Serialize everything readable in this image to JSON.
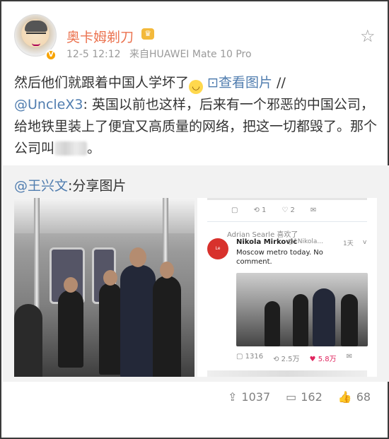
{
  "header": {
    "username": "奥卡姆剃刀",
    "timestamp": "12-5 12:12",
    "source": "来自HUAWEI Mate 10 Pro",
    "verified_badge": "V",
    "crown_badge": "♛",
    "favorite_icon": "star-icon"
  },
  "post": {
    "line1_text": "然后他们就跟着中国人学坏了",
    "emoji_glyph": "😂",
    "view_image_link": "查看图片",
    "view_image_prefix": "⊡",
    "separator": "//",
    "mention": "@UncleX3",
    "quote_text": ": 英国以前也这样，后来有一个邪恶的中国公司，给地铁里装上了便宜又高质量的网络，把这一切都毁了。那个公司叫",
    "quote_end": "。"
  },
  "retweet": {
    "mention": "@王兴文",
    "text": ":分享图片"
  },
  "twitter_screenshot": {
    "top_actions": [
      "▢",
      "⟲ 1",
      "♡ 2",
      "✉"
    ],
    "liked_by": "Adrian Searle 喜欢了",
    "author_name": "Nikola Mirkovic",
    "author_handle": "@1Nikola...",
    "time": "1天",
    "chevron": "v",
    "avatar_text": "Le marteau",
    "tweet_text": "Moscow metro today. No comment.",
    "stats": [
      "▢ 1316",
      "⟲ 2.5万",
      "♥ 5.8万",
      "✉"
    ]
  },
  "actions": {
    "repost_count": "1037",
    "comment_count": "162",
    "like_count": "68"
  },
  "colors": {
    "username": "#eb7350",
    "link": "#507daf",
    "meta": "#9a9a9a"
  }
}
